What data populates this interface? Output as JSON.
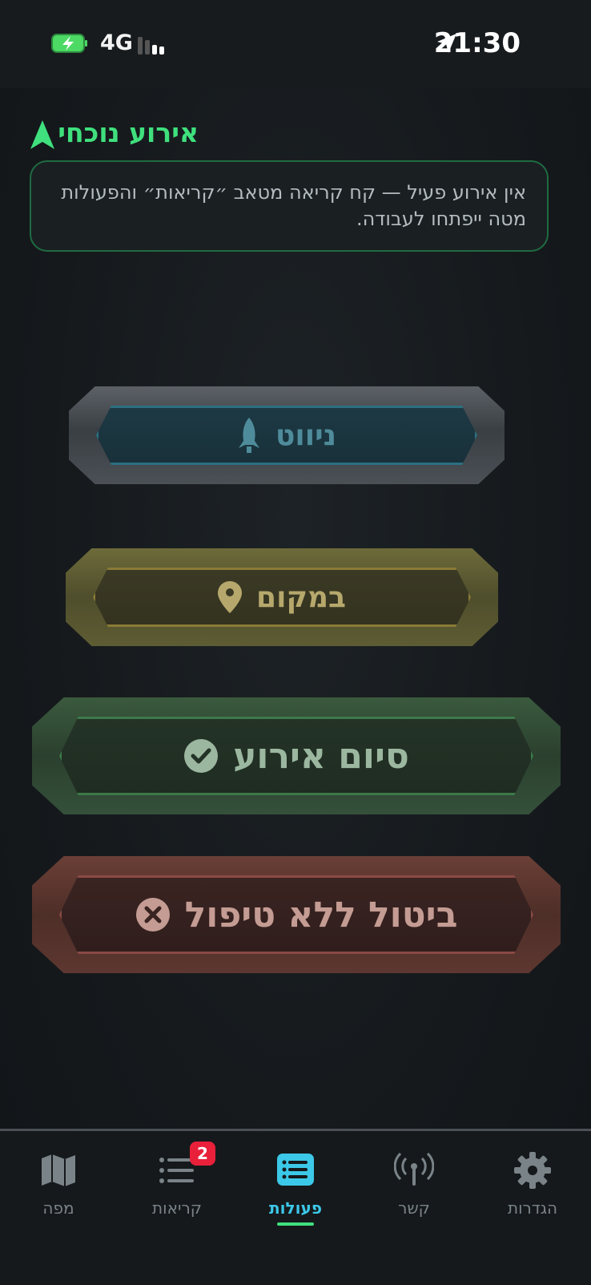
{
  "status_bar": {
    "time": "21:30",
    "network": "4G"
  },
  "current_incident": {
    "title": "אירוע נוכחי",
    "message": "אין אירוע פעיל — קח קריאה מטאב ״קריאות״ והפעולות מטה ייפתחו לעבודה."
  },
  "actions": {
    "navigate_label": "ניווט",
    "on_site_label": "במקום",
    "finish_label": "סיום אירוע",
    "cancel_label": "ביטול ללא טיפול"
  },
  "tabs": [
    {
      "label": "מפה"
    },
    {
      "label": "קריאות",
      "badge": "2"
    },
    {
      "label": "פעולות",
      "active": true
    },
    {
      "label": "קשר"
    },
    {
      "label": "הגדרות"
    }
  ],
  "colors": {
    "accent_green": "#3fe07d",
    "accent_cyan": "#3cc8e8",
    "badge_red": "#e8203a"
  }
}
